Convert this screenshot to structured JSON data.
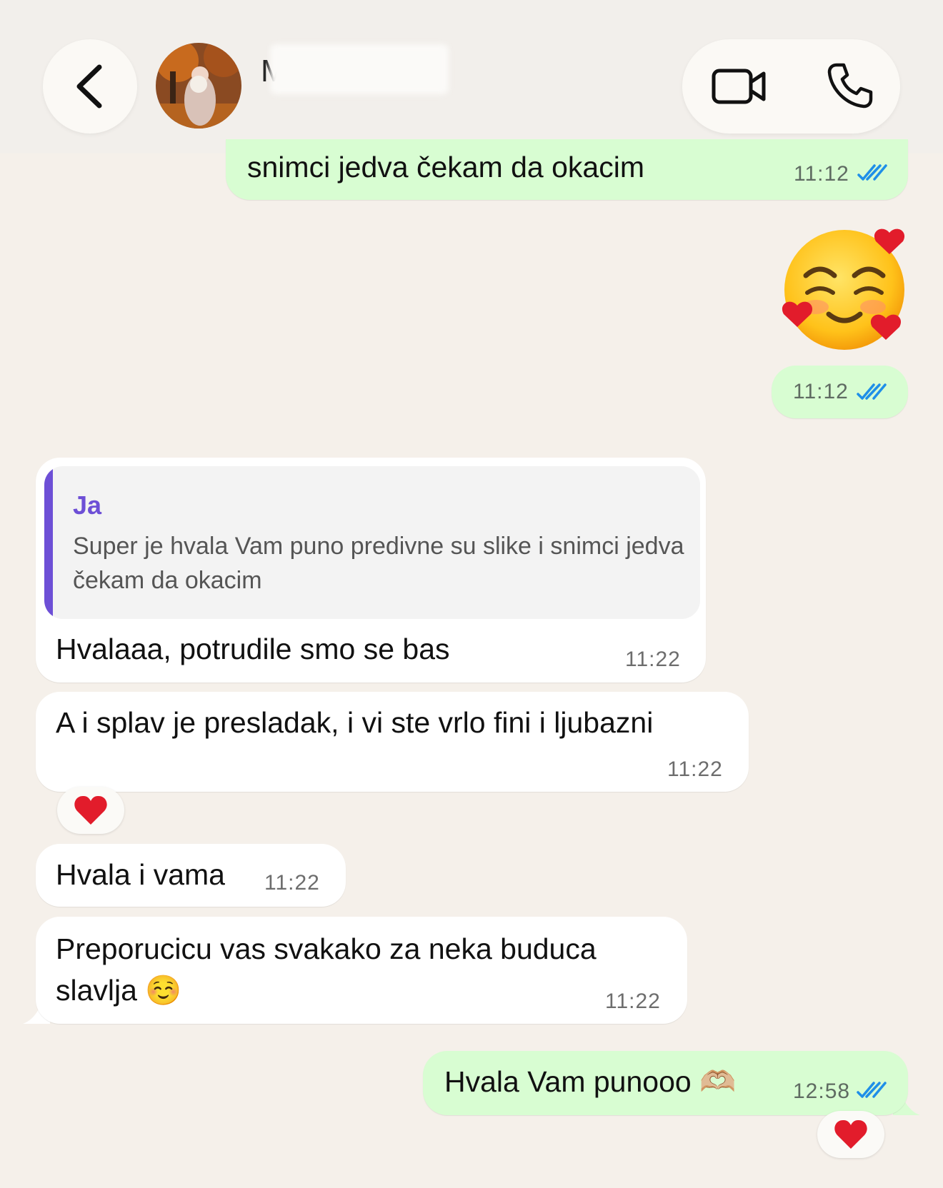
{
  "header": {
    "back_icon": "chevron-left-icon",
    "contact_initial": "M",
    "video_icon": "video-camera-icon",
    "call_icon": "phone-icon"
  },
  "messages": [
    {
      "direction": "outgoing",
      "text": "snimci jedva čekam da okacim",
      "time": "11:12",
      "status": "read"
    },
    {
      "direction": "outgoing",
      "emoji": "smiling-face-with-hearts",
      "time": "11:12",
      "status": "read"
    },
    {
      "direction": "incoming",
      "reply": {
        "author": "Ja",
        "text": "Super je hvala Vam puno predivne su slike i snimci jedva čekam da okacim"
      },
      "text": "Hvalaaa, potrudile smo se bas",
      "time": "11:22"
    },
    {
      "direction": "incoming",
      "text": "A i splav je presladak, i vi ste vrlo fini i ljubazni",
      "time": "11:22",
      "reaction": "red-heart"
    },
    {
      "direction": "incoming",
      "text": "Hvala i vama",
      "time": "11:22"
    },
    {
      "direction": "incoming",
      "text_line1": "Preporucicu vas svakako za neka buduca",
      "text_line2": "slavlja ☺️",
      "time": "11:22"
    },
    {
      "direction": "outgoing",
      "text": "Hvala Vam punooo 🫶🏼",
      "time": "12:58",
      "status": "read",
      "reaction": "red-heart"
    }
  ],
  "colors": {
    "background": "#f5f0ea",
    "outgoing_bubble": "#d8fdd2",
    "incoming_bubble": "#ffffff",
    "read_ticks": "#1f8fe8",
    "reply_accent": "#6d4fd6"
  }
}
